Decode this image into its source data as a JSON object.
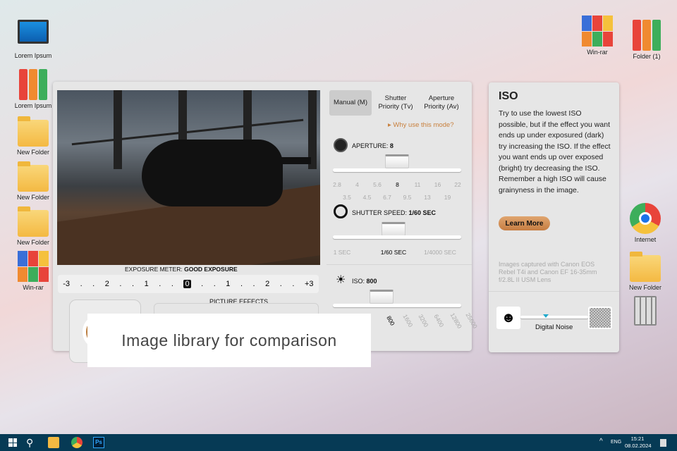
{
  "desktop_left": [
    {
      "label": "Lorem Ipsum",
      "icon": "computer-icon"
    },
    {
      "label": "Lorem Ipsum",
      "icon": "binders-icon"
    },
    {
      "label": "New Folder",
      "icon": "folder-icon"
    },
    {
      "label": "New Folder",
      "icon": "folder-icon"
    },
    {
      "label": "New Folder",
      "icon": "folder-icon"
    },
    {
      "label": "Win-rar",
      "icon": "winrar-icon"
    }
  ],
  "desktop_right": [
    {
      "label": "Win-rar",
      "icon": "winrar-icon"
    },
    {
      "label": "Folder (1)",
      "icon": "binders-icon"
    },
    {
      "label": "Internet",
      "icon": "chrome-icon"
    },
    {
      "label": "New Folder",
      "icon": "folder-icon"
    },
    {
      "label": "",
      "icon": "recycle-bin-icon"
    }
  ],
  "modes": [
    "Manual (M)",
    "Shutter Priority (Tv)",
    "Aperture Priority (Av)"
  ],
  "why_link": "Why use this mode?",
  "aperture": {
    "label": "APERTURE:",
    "value": "8",
    "ticks_top": [
      "2.8",
      "4",
      "5.6",
      "8",
      "11",
      "16",
      "22"
    ],
    "ticks_bottom": [
      "3.5",
      "4.5",
      "6.7",
      "9.5",
      "13",
      "19"
    ]
  },
  "shutter": {
    "label": "SHUTTER SPEED:",
    "value": "1/60 SEC",
    "ticks": [
      "1 SEC",
      "1/60 SEC",
      "1/4000 SEC"
    ]
  },
  "iso": {
    "label": "ISO:",
    "value": "800",
    "ticks": [
      "800",
      "1600",
      "3200",
      "6400",
      "12800",
      "25600"
    ]
  },
  "exposure": {
    "label": "EXPOSURE METER:",
    "value": "GOOD EXPOSURE",
    "scale": [
      "-3",
      ".",
      ".",
      "2",
      ".",
      ".",
      "1",
      ".",
      ".",
      "0",
      ".",
      ".",
      "1",
      ".",
      ".",
      "2",
      ".",
      ".",
      "+3"
    ]
  },
  "picture_effects": "PICTURE EFFECTS",
  "info": {
    "title": "ISO",
    "body": "Try to use the lowest ISO possible, but if the effect you want ends up under exposured (dark) try increasing the ISO. If the effect you want ends up over exposed (bright) try decreasing the ISO. Remember a high ISO will cause grainyness in the image.",
    "button": "Learn More",
    "caption": "Images captured with Canon EOS Rebel T4i and Canon EF 16-35mm f/2.8L II USM Lens",
    "noise_label": "Digital Noise"
  },
  "banner": "Image library for comparison",
  "taskbar": {
    "lang": "ENG",
    "time": "15:21",
    "date": "08.02.2024"
  }
}
